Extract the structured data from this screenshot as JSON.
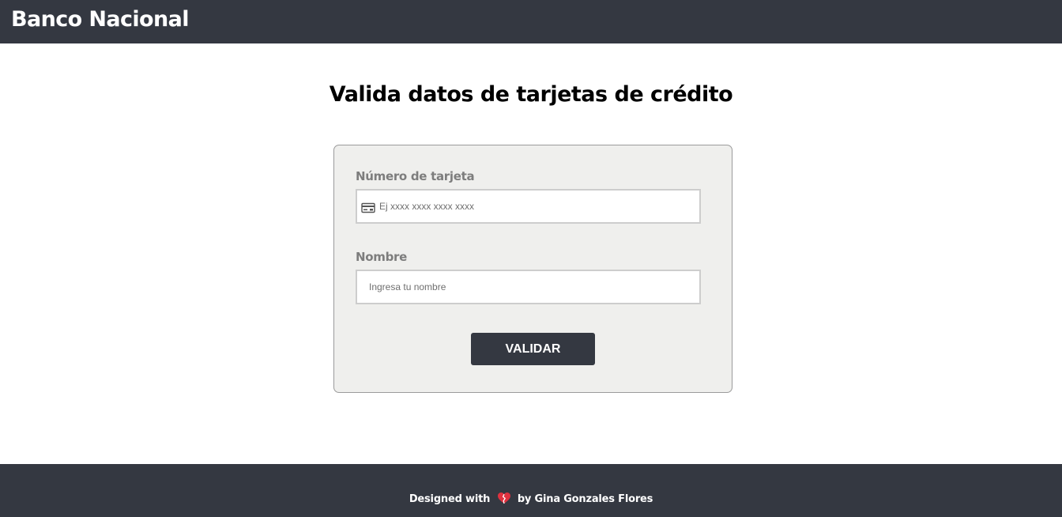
{
  "header": {
    "brand": "Banco Nacional"
  },
  "main": {
    "title": "Valida datos de tarjetas de crédito"
  },
  "form": {
    "card_number": {
      "label": "Número de tarjeta",
      "placeholder": "Ej xxxx xxxx xxxx xxxx",
      "value": "",
      "icon": "credit-card-icon"
    },
    "name": {
      "label": "Nombre",
      "placeholder": "Ingresa tu nombre",
      "value": ""
    },
    "submit_label": "VALIDAR"
  },
  "footer": {
    "prefix": "Designed with",
    "icon": "broken-heart-icon",
    "suffix": "by Gina Gonzales Flores"
  },
  "colors": {
    "header_bg": "#343841",
    "card_bg": "#efefed",
    "label": "#7d7d7d",
    "button_bg": "#343841",
    "heart": "#e0313f"
  }
}
